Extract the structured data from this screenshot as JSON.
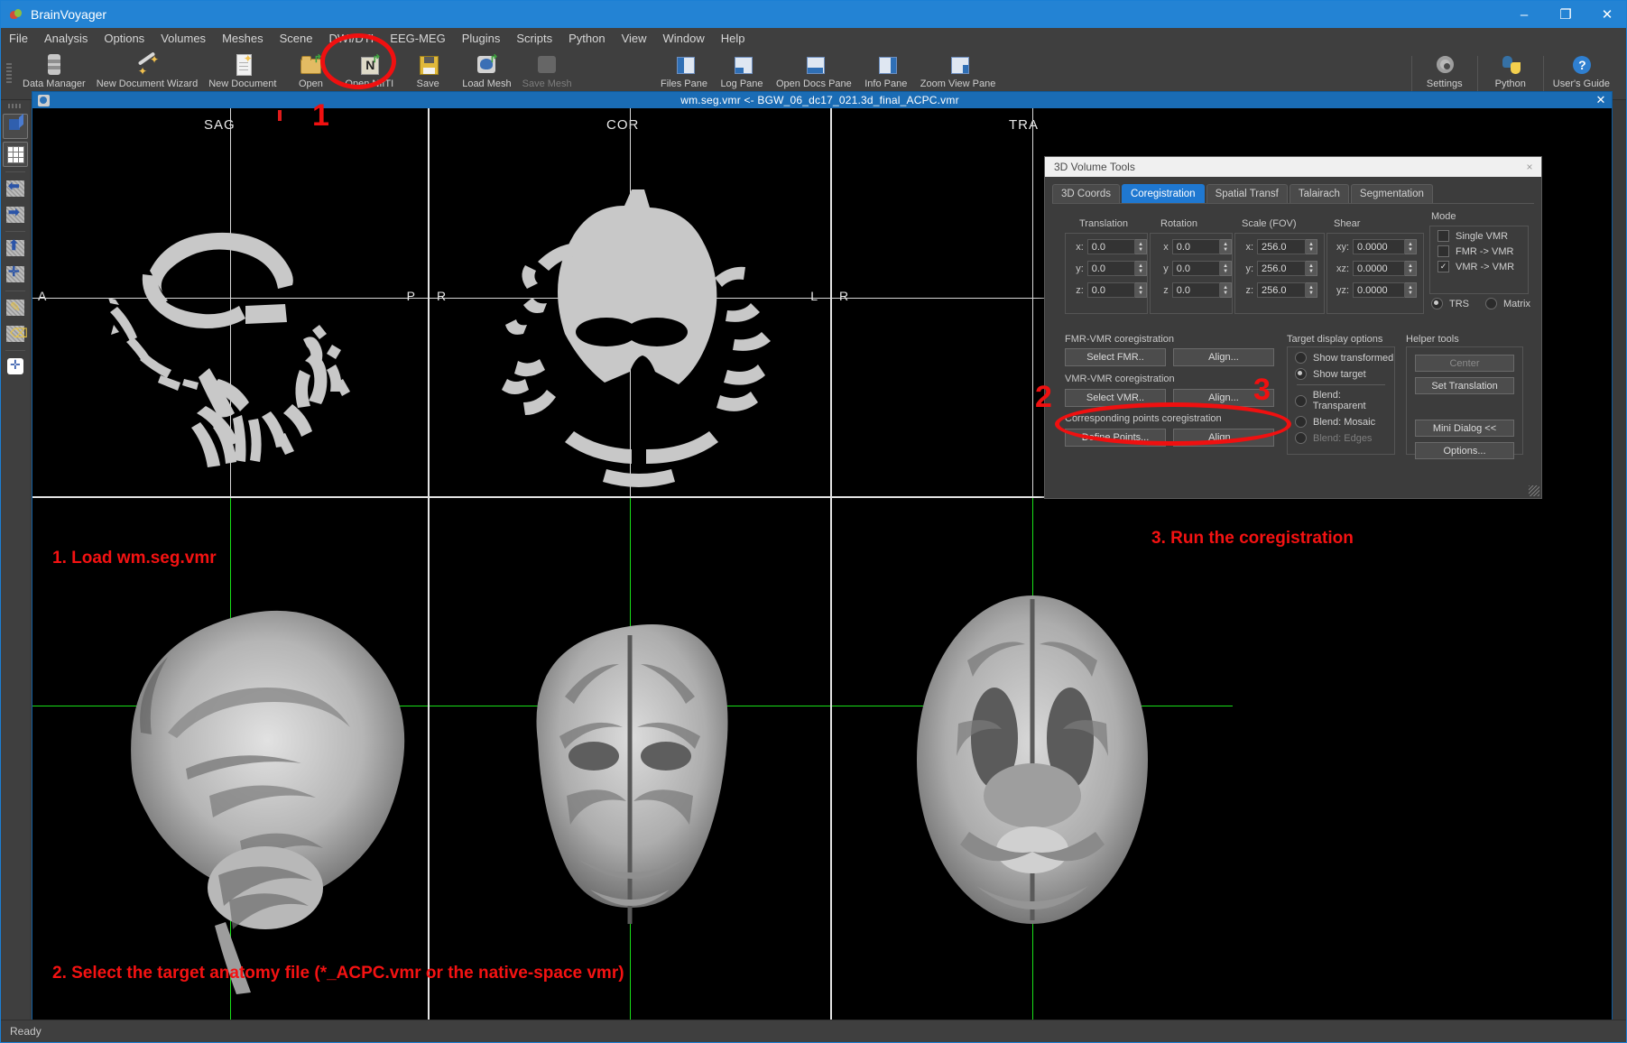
{
  "window": {
    "app_title": "BrainVoyager",
    "icon": "brain-icon",
    "minimize": "–",
    "maximize": "❐",
    "close": "✕"
  },
  "menubar": [
    {
      "label": "File",
      "mnemonic": "F"
    },
    {
      "label": "Analysis",
      "mnemonic": "A"
    },
    {
      "label": "Options",
      "mnemonic": "O"
    },
    {
      "label": "Volumes",
      "mnemonic": "V"
    },
    {
      "label": "Meshes",
      "mnemonic": "M"
    },
    {
      "label": "Scene",
      "mnemonic": "S"
    },
    {
      "label": "DWI/DTI",
      "mnemonic": "D"
    },
    {
      "label": "EEG-MEG",
      "mnemonic": "E"
    },
    {
      "label": "Plugins",
      "mnemonic": "P"
    },
    {
      "label": "Scripts",
      "mnemonic": "c"
    },
    {
      "label": "Python",
      "mnemonic": "P"
    },
    {
      "label": "View",
      "mnemonic": "V"
    },
    {
      "label": "Window",
      "mnemonic": "W"
    },
    {
      "label": "Help",
      "mnemonic": "H"
    }
  ],
  "toolbar": {
    "left_items": [
      {
        "label": "Data Manager",
        "icon": "database-icon",
        "enabled": true
      },
      {
        "label": "New Document Wizard",
        "icon": "wand-icon",
        "enabled": true
      },
      {
        "label": "New Document",
        "icon": "new-document-icon",
        "enabled": true
      },
      {
        "label": "Open",
        "icon": "open-folder-icon",
        "enabled": true
      },
      {
        "label": "Open NIfTI",
        "icon": "nifti-icon",
        "enabled": true
      },
      {
        "label": "Save",
        "icon": "floppy-save-icon",
        "enabled": true
      },
      {
        "label": "Load Mesh",
        "icon": "load-mesh-icon",
        "enabled": true
      },
      {
        "label": "Save Mesh",
        "icon": "save-mesh-icon",
        "enabled": false
      }
    ],
    "pane_items": [
      {
        "label": "Files Pane",
        "icon": "files-pane-icon"
      },
      {
        "label": "Log Pane",
        "icon": "log-pane-icon"
      },
      {
        "label": "Open Docs Pane",
        "icon": "open-docs-pane-icon"
      },
      {
        "label": "Info Pane",
        "icon": "info-pane-icon"
      },
      {
        "label": "Zoom View Pane",
        "icon": "zoom-view-pane-icon"
      }
    ],
    "right_items": [
      {
        "label": "Settings",
        "icon": "gear-icon"
      },
      {
        "label": "Python",
        "icon": "python-icon"
      },
      {
        "label": "User's Guide",
        "icon": "help-icon"
      }
    ]
  },
  "sidebar": {
    "items": [
      {
        "name": "volume-3d-view",
        "icon": "cube-icon",
        "selected": true
      },
      {
        "name": "multi-slice-view",
        "icon": "grid-icon",
        "selected": true
      },
      {
        "name": "move-slice-left",
        "icon": "arrow-left-icon"
      },
      {
        "name": "move-slice-right",
        "icon": "arrow-right-icon"
      },
      {
        "name": "move-slice-up",
        "icon": "arrow-up-icon"
      },
      {
        "name": "move-slice-center",
        "icon": "arrow-center-icon"
      },
      {
        "name": "paint-tool",
        "icon": "brush-icon"
      },
      {
        "name": "erase-tool",
        "icon": "eraser-icon"
      },
      {
        "name": "crosshair-tool",
        "icon": "crosshair-icon"
      }
    ]
  },
  "document": {
    "title": "wm.seg.vmr  <-  BGW_06_dc17_021.3d_final_ACPC.vmr",
    "close": "✕",
    "icon": "document-icon",
    "panes": [
      {
        "name": "sagittal-top",
        "label": "SAG",
        "orientation_left": "A",
        "orientation_right": "P"
      },
      {
        "name": "coronal-top",
        "label": "COR",
        "orientation_left": "R",
        "orientation_right": "L"
      },
      {
        "name": "transversal-top",
        "label": "TRA",
        "orientation_left": "R",
        "orientation_right": ""
      },
      {
        "name": "sagittal-bottom",
        "label": "",
        "orientation_left": "",
        "orientation_right": ""
      },
      {
        "name": "coronal-bottom",
        "label": "",
        "orientation_left": "",
        "orientation_right": ""
      },
      {
        "name": "transversal-bottom",
        "label": "",
        "orientation_left": "",
        "orientation_right": ""
      }
    ]
  },
  "annotations": {
    "step1_number": "1",
    "step2_number": "2",
    "step3_number": "3",
    "step1_text": "1. Load wm.seg.vmr",
    "step2_text": "2. Select the target anatomy file (*_ACPC.vmr or the native-space vmr)",
    "step3_text": "3. Run the coregistration",
    "highlight_color": "#f01010"
  },
  "dialog": {
    "title": "3D Volume Tools",
    "close": "×",
    "tabs": [
      {
        "label": "3D Coords",
        "active": false
      },
      {
        "label": "Coregistration",
        "active": true
      },
      {
        "label": "Spatial Transf",
        "active": false
      },
      {
        "label": "Talairach",
        "active": false
      },
      {
        "label": "Segmentation",
        "active": false
      }
    ],
    "param_groups": [
      {
        "title": "Translation",
        "fields": [
          {
            "label": "x:",
            "value": "0.0"
          },
          {
            "label": "y:",
            "value": "0.0"
          },
          {
            "label": "z:",
            "value": "0.0"
          }
        ]
      },
      {
        "title": "Rotation",
        "fields": [
          {
            "label": "x",
            "value": "0.0"
          },
          {
            "label": "y",
            "value": "0.0"
          },
          {
            "label": "z",
            "value": "0.0"
          }
        ]
      },
      {
        "title": "Scale (FOV)",
        "fields": [
          {
            "label": "x:",
            "value": "256.0"
          },
          {
            "label": "y:",
            "value": "256.0"
          },
          {
            "label": "z:",
            "value": "256.0"
          }
        ]
      },
      {
        "title": "Shear",
        "fields": [
          {
            "label": "xy:",
            "value": "0.0000"
          },
          {
            "label": "xz:",
            "value": "0.0000"
          },
          {
            "label": "yz:",
            "value": "0.0000"
          }
        ]
      }
    ],
    "mode": {
      "title": "Mode",
      "options": [
        {
          "label": "Single VMR",
          "checked": false
        },
        {
          "label": "FMR -> VMR",
          "checked": false
        },
        {
          "label": "VMR -> VMR",
          "checked": true,
          "check_glyph": "✓"
        }
      ],
      "radios": [
        {
          "label": "TRS",
          "selected": true
        },
        {
          "label": "Matrix",
          "selected": false
        }
      ]
    },
    "fmr_vmr": {
      "title": "FMR-VMR coregistration",
      "select_button": "Select FMR..",
      "align_button": "Align...",
      "align_mnemonic": "A"
    },
    "vmr_vmr": {
      "title": "VMR-VMR coregistration",
      "select_button": "Select VMR..",
      "align_button": "Align...",
      "align_mnemonic": "li"
    },
    "corresponding_points": {
      "title": "Corresponding points coregistration",
      "define_button": "Define Points...",
      "align_button": "Align...",
      "align_mnemonic": "li"
    },
    "target_display": {
      "title": "Target display options",
      "options": [
        {
          "label": "Show transformed",
          "selected": false,
          "enabled": true
        },
        {
          "label": "Show target",
          "selected": true,
          "enabled": true
        },
        {
          "label": "Blend: Transparent",
          "selected": false,
          "enabled": true
        },
        {
          "label": "Blend: Mosaic",
          "selected": false,
          "enabled": true
        },
        {
          "label": "Blend: Edges",
          "selected": false,
          "enabled": false
        }
      ]
    },
    "helper_tools": {
      "title": "Helper tools",
      "buttons": [
        {
          "label": "Center",
          "enabled": false
        },
        {
          "label": "Set Translation",
          "enabled": true
        },
        {
          "label": "Mini Dialog <<",
          "enabled": true,
          "mnemonic": "M"
        },
        {
          "label": "Options...",
          "enabled": true
        }
      ]
    }
  },
  "statusbar": {
    "text": "Ready"
  }
}
